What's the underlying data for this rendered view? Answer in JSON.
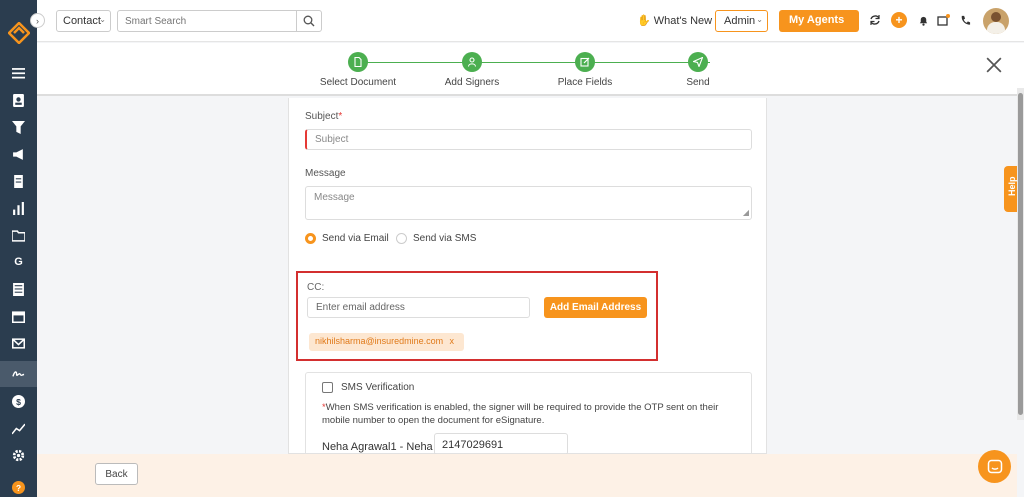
{
  "topbar": {
    "contact_select": "Contact",
    "search_placeholder": "Smart Search",
    "whats_new": "What's New",
    "admin_select": "Admin",
    "agents_button": "My Agents"
  },
  "steps": [
    {
      "label": "Select Document",
      "icon": "document-icon"
    },
    {
      "label": "Add Signers",
      "icon": "user-icon"
    },
    {
      "label": "Place Fields",
      "icon": "edit-icon"
    },
    {
      "label": "Send",
      "icon": "send-icon"
    }
  ],
  "form": {
    "subject_label": "Subject",
    "subject_required": "*",
    "subject_placeholder": "Subject",
    "message_label": "Message",
    "message_placeholder": "Message",
    "radio_email": "Send via Email",
    "radio_sms": "Send via SMS",
    "selected_method": "email"
  },
  "cc": {
    "label": "CC:",
    "input_placeholder": "Enter email address",
    "add_button": "Add Email Address",
    "chips": [
      {
        "email": "nikhilsharma@insuredmine.com",
        "remove": "x"
      }
    ]
  },
  "sms": {
    "title": "SMS Verification",
    "note_asterisk": "*",
    "note": "When SMS verification is enabled, the signer will be required to provide the OTP sent on their mobile number to open the document for eSignature.",
    "signer_name": "Neha Agrawal1 - Neha",
    "signer_phone": "2147029691"
  },
  "footer": {
    "back_button": "Back"
  },
  "help_tab": "Help",
  "colors": {
    "sidebar": "#2b3d4f",
    "accent": "#f7941d",
    "step": "#4caf50",
    "highlight": "#d32f2f",
    "footer": "#fdf1e6"
  }
}
